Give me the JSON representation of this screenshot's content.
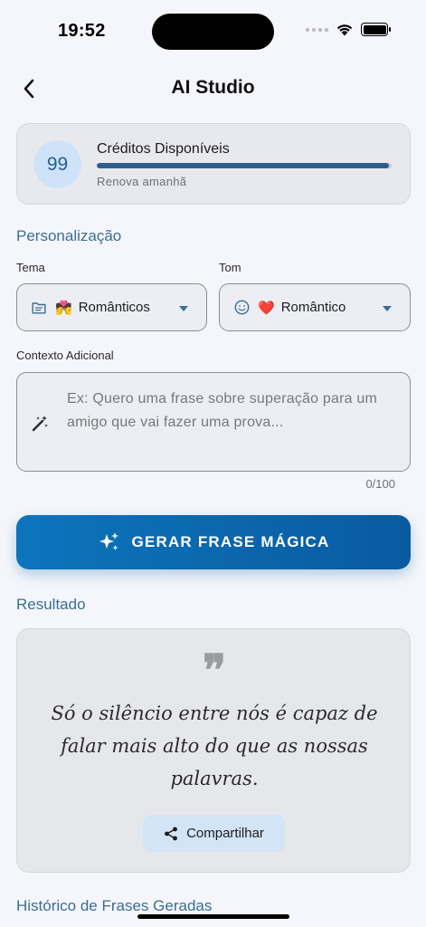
{
  "status_bar": {
    "time": "19:52"
  },
  "nav": {
    "title": "AI Studio",
    "back_icon": "chevron-left-icon"
  },
  "credits": {
    "count": "99",
    "title": "Créditos Disponíveis",
    "subtitle": "Renova amanhã",
    "progress": 0.99,
    "bar_color": "#2d5d8c"
  },
  "personalization": {
    "heading": "Personalização",
    "theme": {
      "label": "Tema",
      "icon": "folder-icon",
      "emoji": "💏",
      "value": "Românticos"
    },
    "tone": {
      "label": "Tom",
      "icon": "smiley-icon",
      "emoji": "❤️",
      "value": "Romântico"
    },
    "context": {
      "label": "Contexto Adicional",
      "placeholder": "Ex: Quero uma frase sobre superação para um amigo que vai fazer uma prova...",
      "counter": "0/100",
      "icon": "magic-wand-icon"
    }
  },
  "generate_button": {
    "label": "GERAR FRASE MÁGICA",
    "icon": "sparkles-icon",
    "color": "#0c75bc"
  },
  "result": {
    "heading": "Resultado",
    "quote_mark": "❞",
    "text": "Só o silêncio entre nós é capaz de falar mais alto do que as nossas palavras.",
    "share_label": "Compartilhar",
    "share_icon": "share-icon"
  },
  "history": {
    "heading": "Histórico de Frases Geradas"
  }
}
